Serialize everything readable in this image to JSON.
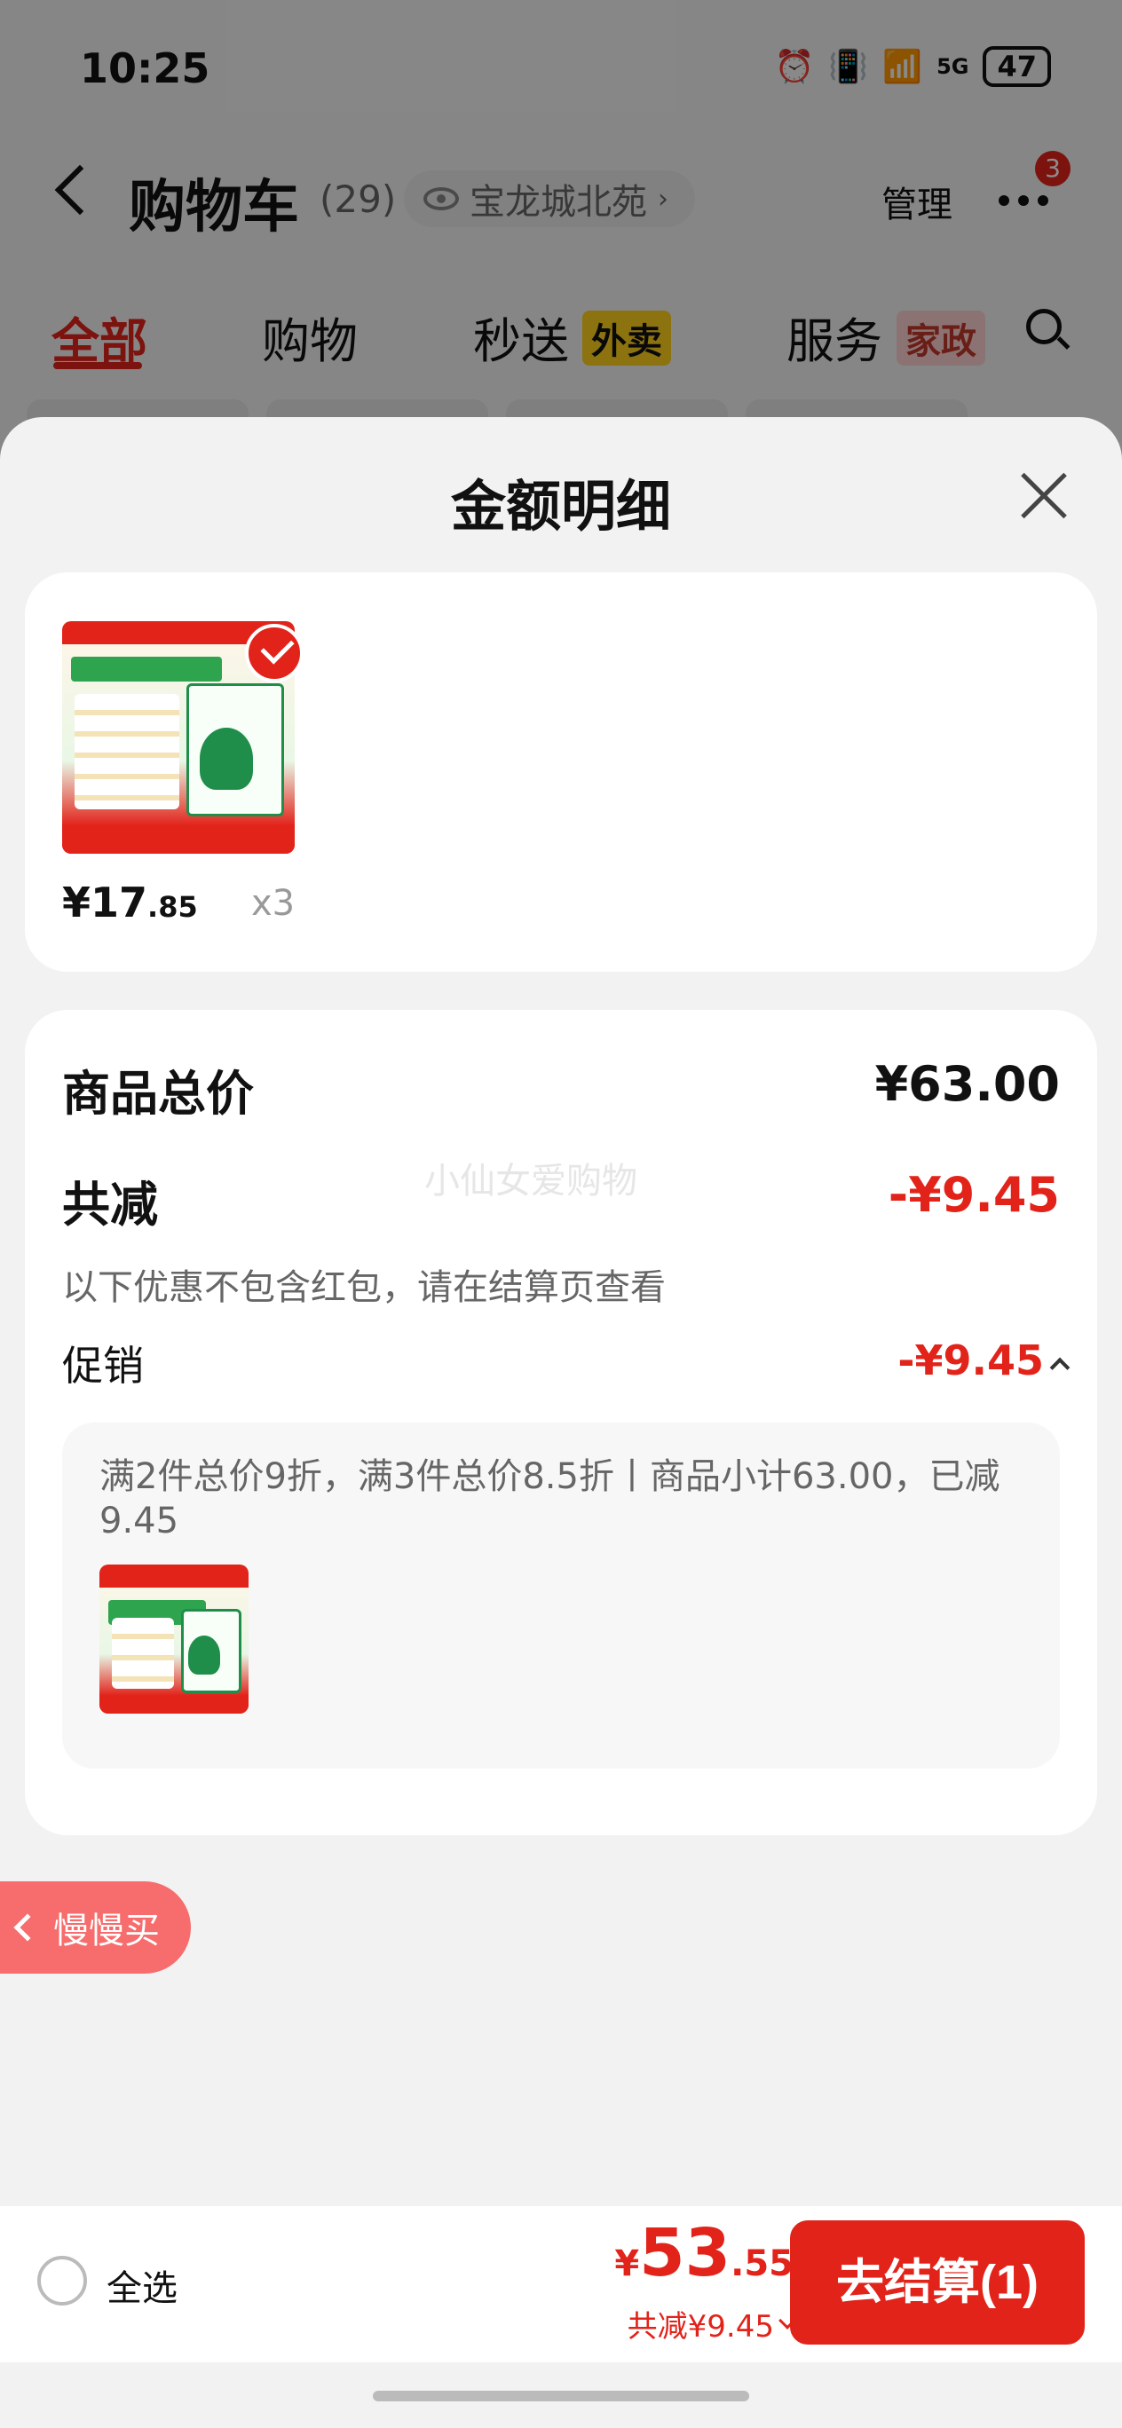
{
  "status_bar": {
    "time": "10:25",
    "network": "5G",
    "battery": "47"
  },
  "header": {
    "title": "购物车",
    "count": "(29)",
    "location": "宝龙城北苑",
    "manage": "管理",
    "badge": "3"
  },
  "tabs": [
    {
      "label": "全部",
      "active": true
    },
    {
      "label": "购物"
    },
    {
      "label": "秒送",
      "tag": "外卖"
    },
    {
      "label": "服务",
      "tag": "家政"
    }
  ],
  "sheet": {
    "title": "金额明细",
    "product": {
      "price_main": "¥17",
      "price_cents": ".85",
      "qty": "x3"
    },
    "summary": {
      "goods_total_label": "商品总价",
      "goods_total_value": "¥63.00",
      "reduce_label": "共减",
      "reduce_value": "-¥9.45",
      "note": "以下优惠不包含红包，请在结算页查看",
      "promo_label": "促销",
      "promo_value": "-¥9.45",
      "promo_detail": "满2件总价9折，满3件总价8.5折丨商品小计63.00，已减9.45",
      "watermark": "小仙女爱购物"
    }
  },
  "slow_buy": "慢慢买",
  "bottom_bar": {
    "select_all": "全选",
    "total_yen": "¥",
    "total_main": "53",
    "total_cents": ".55",
    "saved": "共减¥9.45",
    "checkout": "去结算(1)"
  },
  "colors": {
    "accent": "#e2231a",
    "sheet_bg": "#f2f2f2",
    "card_bg": "#ffffff"
  }
}
